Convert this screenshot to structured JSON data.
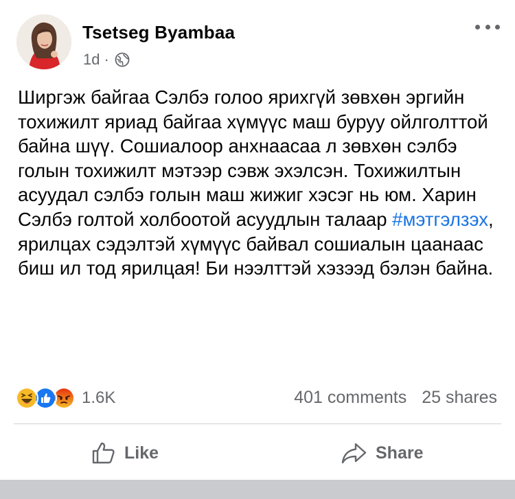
{
  "post": {
    "author": "Tsetseg Byambaa",
    "time": "1d",
    "separator": "·",
    "privacy_icon": "globe-icon",
    "text_before_hashtag": "Ширгэж байгаа Сэлбэ голоо ярихгүй зөвхөн эргийн тохижилт яриад байгаа хүмүүс маш буруу ойлголттой байна шүү. Сошиалоор анхнаасаа л зөвхөн сэлбэ голын тохижилт мэтээр сэвж эхэлсэн. Тохижилтын асуудал сэлбэ голын маш жижиг хэсэг нь юм. Харин Сэлбэ голтой холбоотой асуудлын талаар ",
    "hashtag": "#мэтгэлзэх",
    "text_after_hashtag": ", ярилцах сэдэлтэй хүмүүс байвал сошиалын цаанаас биш ил тод ярилцая! Би нээлттэй хэзээд бэлэн байна."
  },
  "reactions": {
    "icons": [
      "haha-icon",
      "like-icon",
      "angry-icon"
    ],
    "count": "1.6K"
  },
  "stats": {
    "comments": "401 comments",
    "shares": "25 shares"
  },
  "actions": {
    "like_label": "Like",
    "share_label": "Share"
  },
  "colors": {
    "hashtag": "#1b74e4",
    "secondary_text": "#65676b",
    "like_blue": "#1877f2",
    "haha_yellow": "#f7b928",
    "angry_red": "#e9710f"
  }
}
